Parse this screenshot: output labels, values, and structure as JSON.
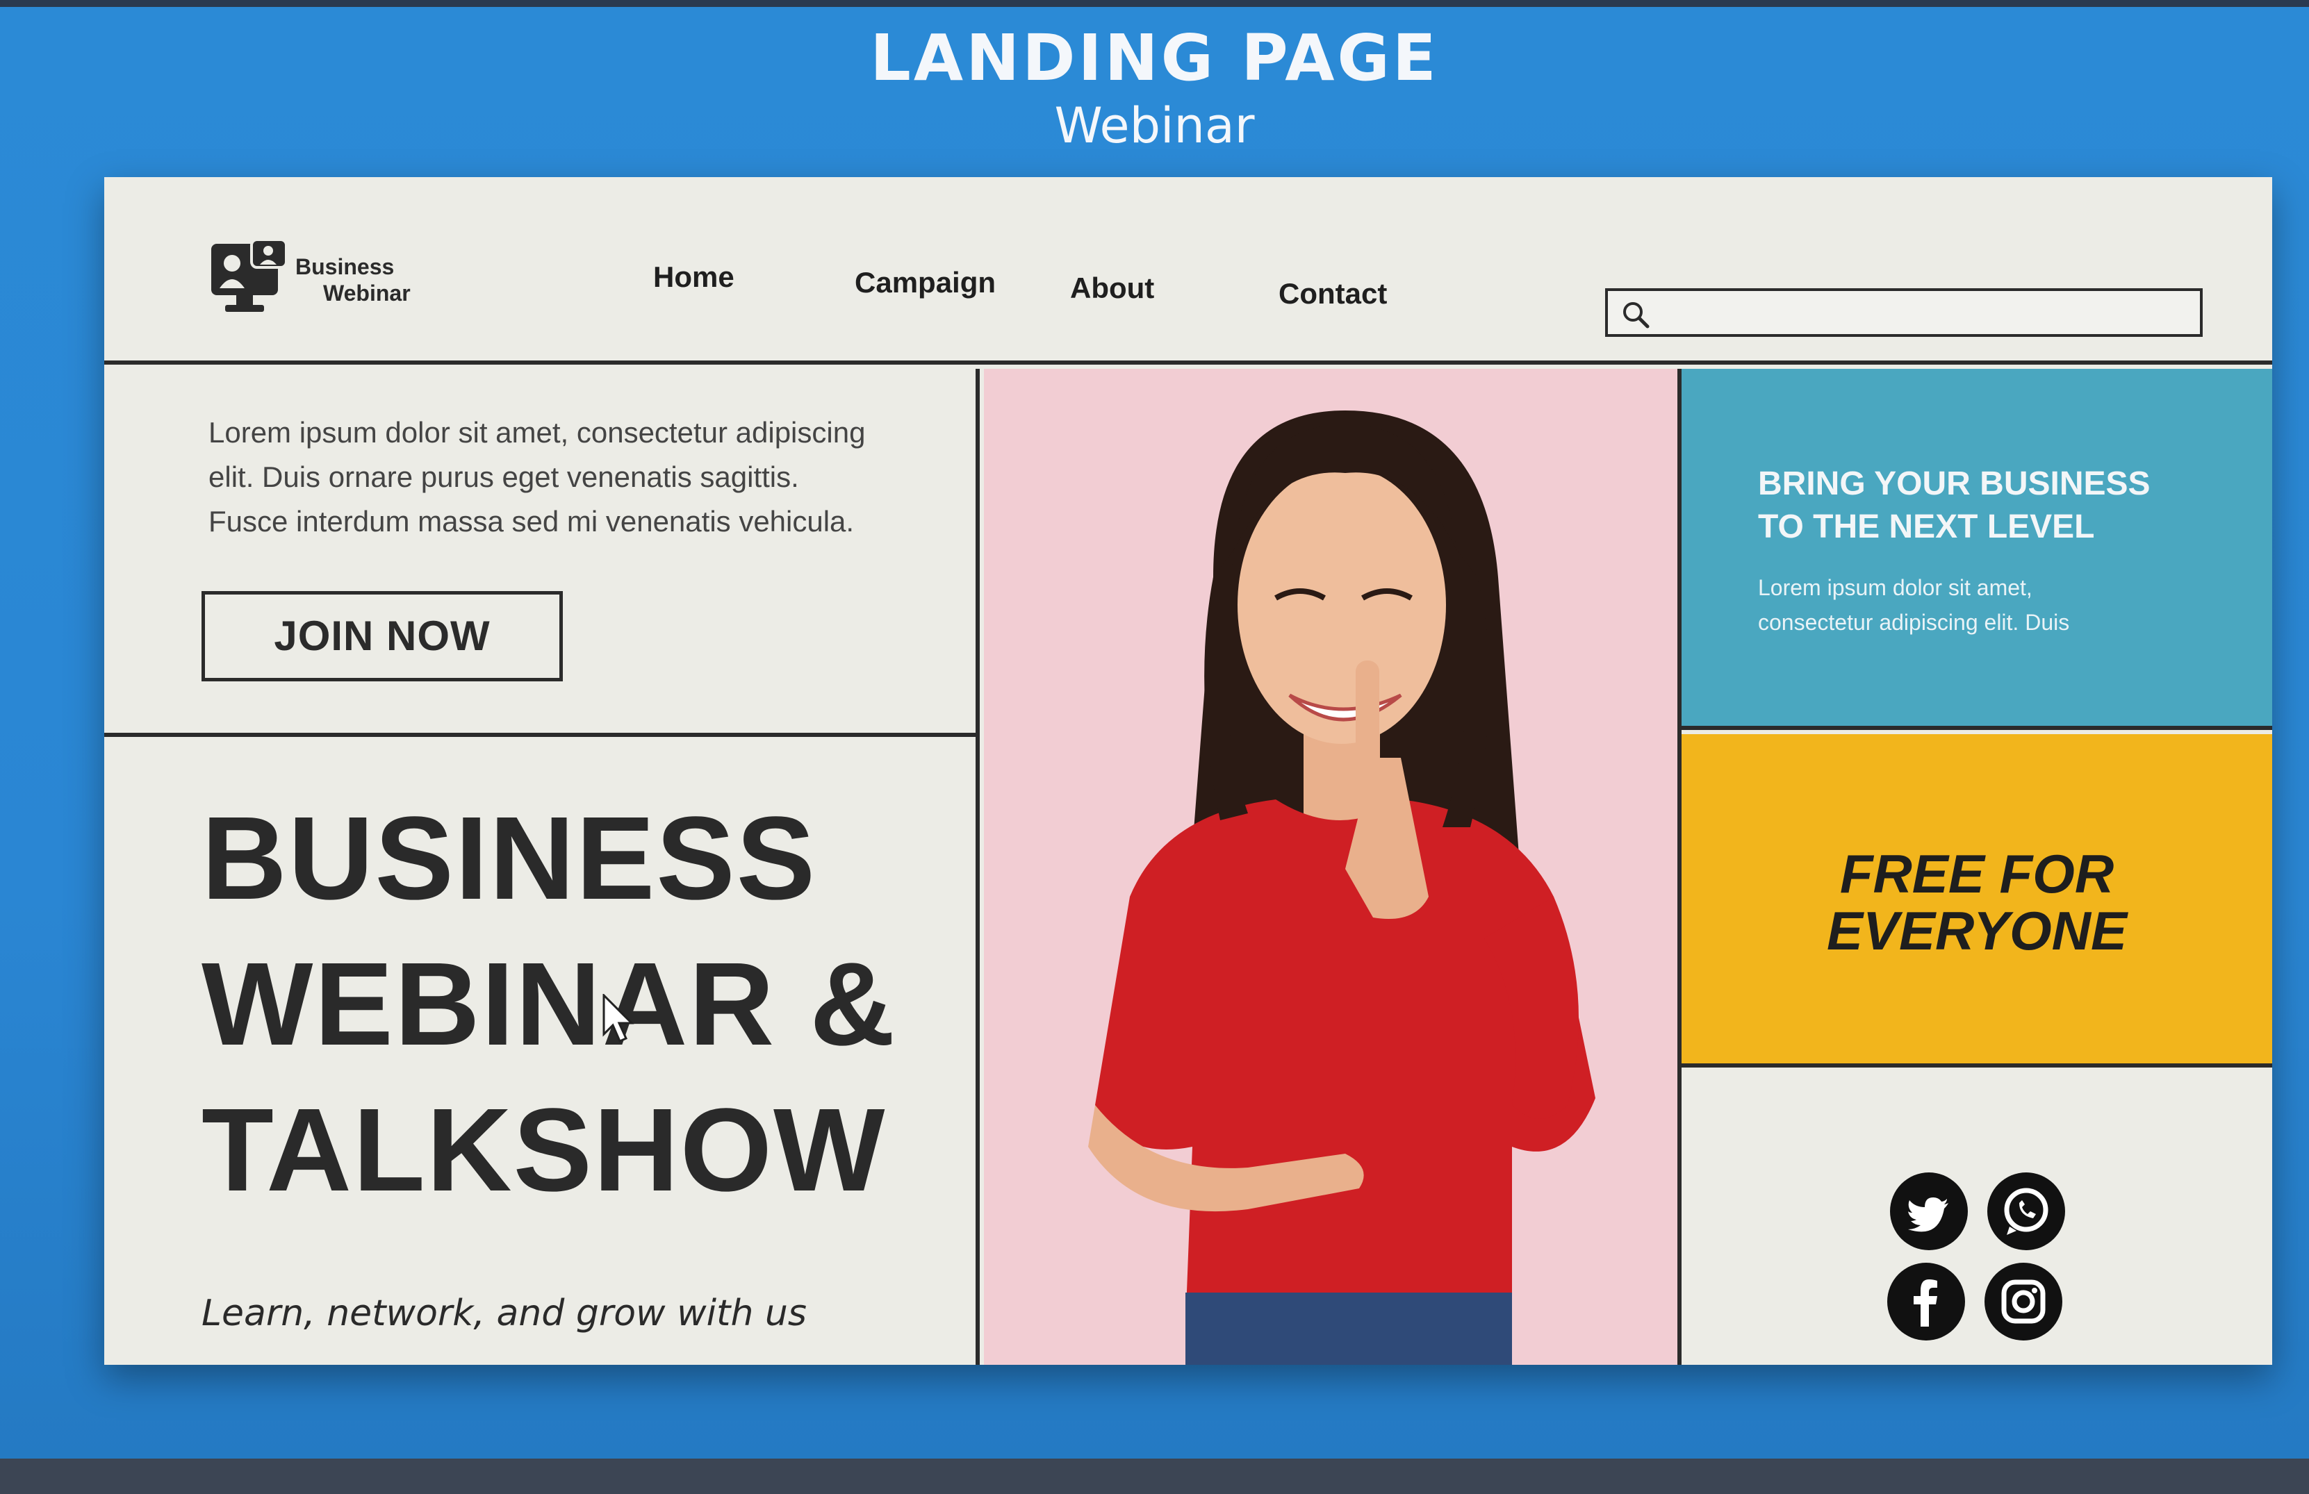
{
  "screenshot": {
    "title": "LANDING PAGE",
    "subtitle": "Webinar"
  },
  "header": {
    "logo_line1": "Business",
    "logo_line2": "Webinar",
    "nav": [
      "Home",
      "Campaign",
      "About",
      "Contact"
    ],
    "search_icon": "search-icon",
    "search_value": ""
  },
  "hero": {
    "intro_lines": [
      "Lorem ipsum dolor sit amet, consectetur adipiscing",
      "elit. Duis ornare purus eget venenatis sagittis.",
      "Fusce interdum massa sed mi venenatis vehicula."
    ],
    "cta_label": "JOIN NOW",
    "headline_lines": [
      "BUSINESS",
      "WEBINAR &",
      "TALKSHOW"
    ],
    "tagline": "Learn, network, and grow with us"
  },
  "promo": {
    "teal_title_lines": [
      "BRING YOUR BUSINESS",
      "TO THE NEXT LEVEL"
    ],
    "teal_body_lines": [
      "Lorem ipsum dolor sit amet,",
      "consectetur adipiscing elit. Duis"
    ],
    "free_lines": [
      "FREE FOR",
      "EVERYONE"
    ]
  },
  "social": {
    "icons": [
      "twitter-icon",
      "whatsapp-icon",
      "facebook-icon",
      "instagram-icon"
    ]
  },
  "colors": {
    "background": "#2b8ad6",
    "page": "#ecece6",
    "teal": "#4aa7c0",
    "yellow": "#f2b51c",
    "photo_bg": "#f2cdd3",
    "shirt": "#cf1f24"
  }
}
